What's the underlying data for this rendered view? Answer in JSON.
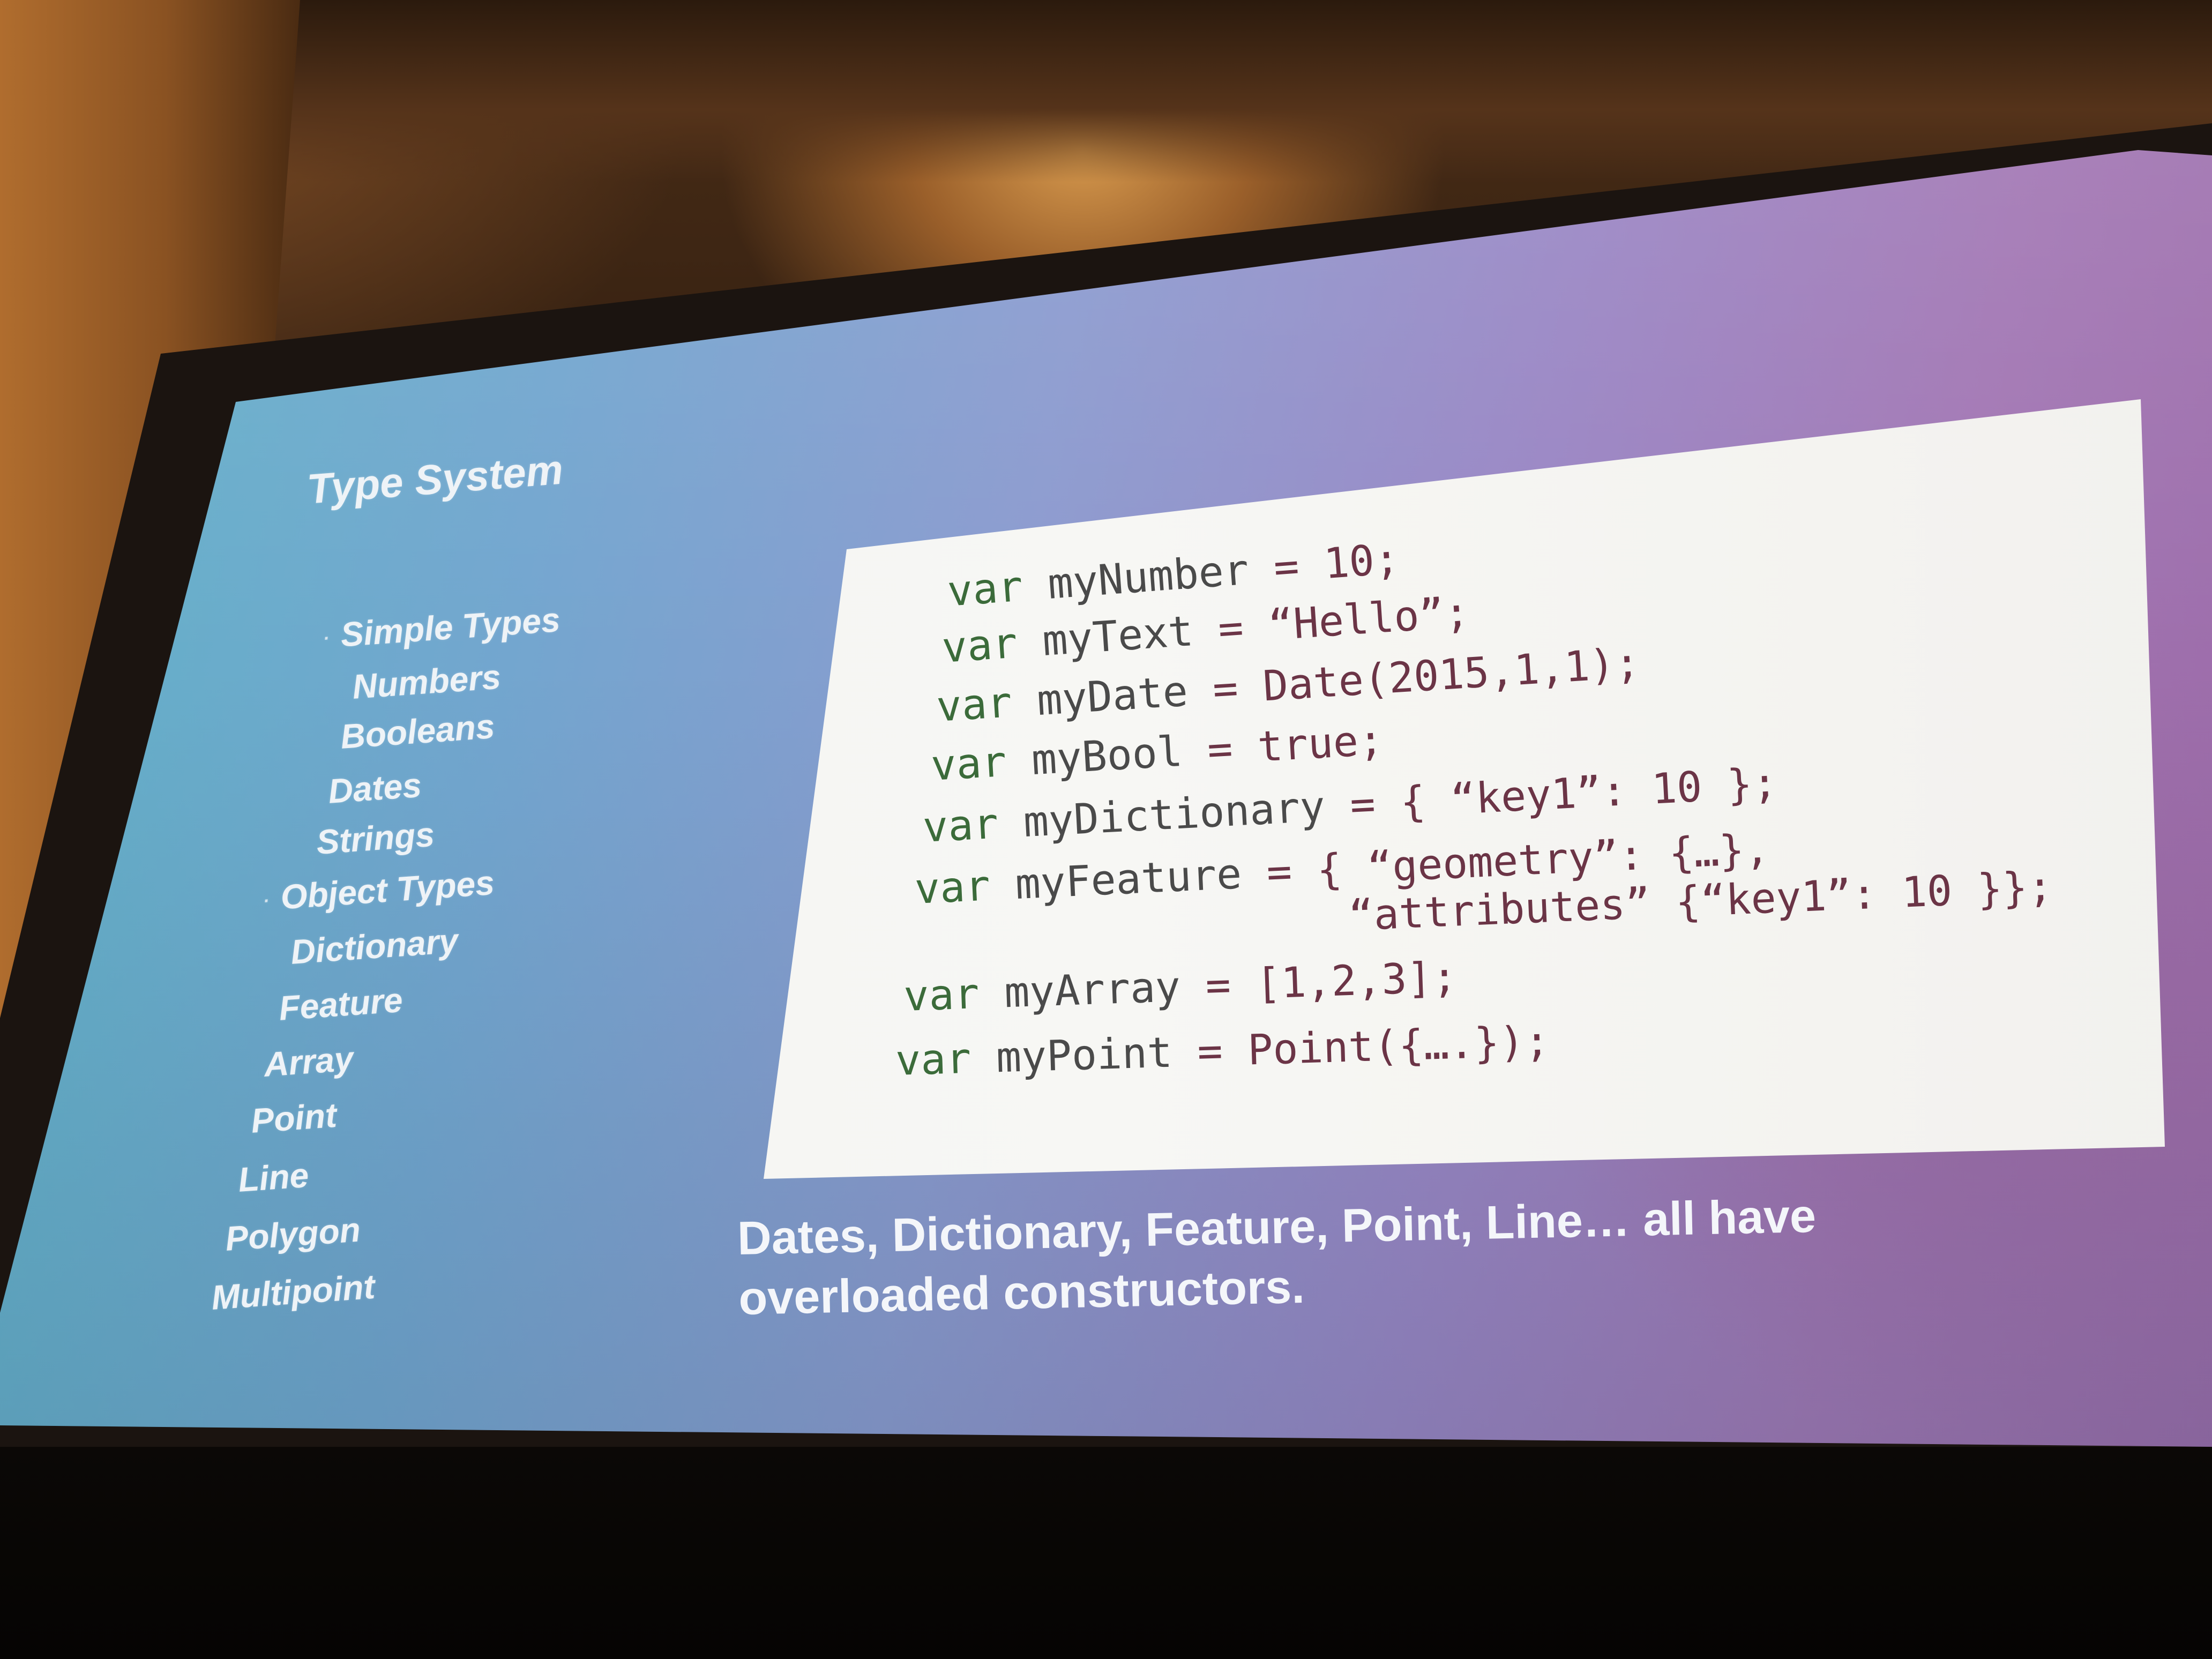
{
  "slide": {
    "title": "Type System",
    "outline": [
      {
        "label": "Simple Types",
        "bullet": "·"
      },
      {
        "label": "Numbers"
      },
      {
        "label": "Booleans"
      },
      {
        "label": "Dates"
      },
      {
        "label": "Strings"
      },
      {
        "label": "Object Types",
        "bullet": "·"
      },
      {
        "label": "Dictionary"
      },
      {
        "label": "Feature"
      },
      {
        "label": "Array"
      },
      {
        "label": "Point"
      },
      {
        "label": "Line"
      },
      {
        "label": "Polygon"
      },
      {
        "label": "Multipoint"
      }
    ],
    "code": {
      "keyword": "var",
      "lines": [
        {
          "name": "myNumber",
          "rest": " = 10;"
        },
        {
          "name": "myText",
          "rest": " = “Hello”;"
        },
        {
          "name": "myDate",
          "rest": " = Date(2015,1,1);"
        },
        {
          "name": "myBool",
          "rest": " = true;"
        },
        {
          "name": "myDictionary",
          "rest": " = { “key1”: 10 };"
        },
        {
          "name": "myFeature",
          "rest": " = { “geometry”:  {…},"
        },
        {
          "continuation": "“attributes” {“key1”: 10 }};"
        },
        {
          "name": "myArray",
          "rest": " = [1,2,3];"
        },
        {
          "name": "myPoint",
          "rest": " = Point({….});"
        }
      ]
    },
    "footer": {
      "line1": "Dates, Dictionary, Feature, Point, Line… all have",
      "line2": "overloaded constructors."
    }
  },
  "colors": {
    "slide_gradient_left": "#5fb3c6",
    "slide_gradient_right": "#9b6aa8",
    "code_panel": "#f3f4f1",
    "code_keyword": "#3b6b3a",
    "code_text": "#4a4a4a",
    "slide_text": "#eef3f7"
  }
}
